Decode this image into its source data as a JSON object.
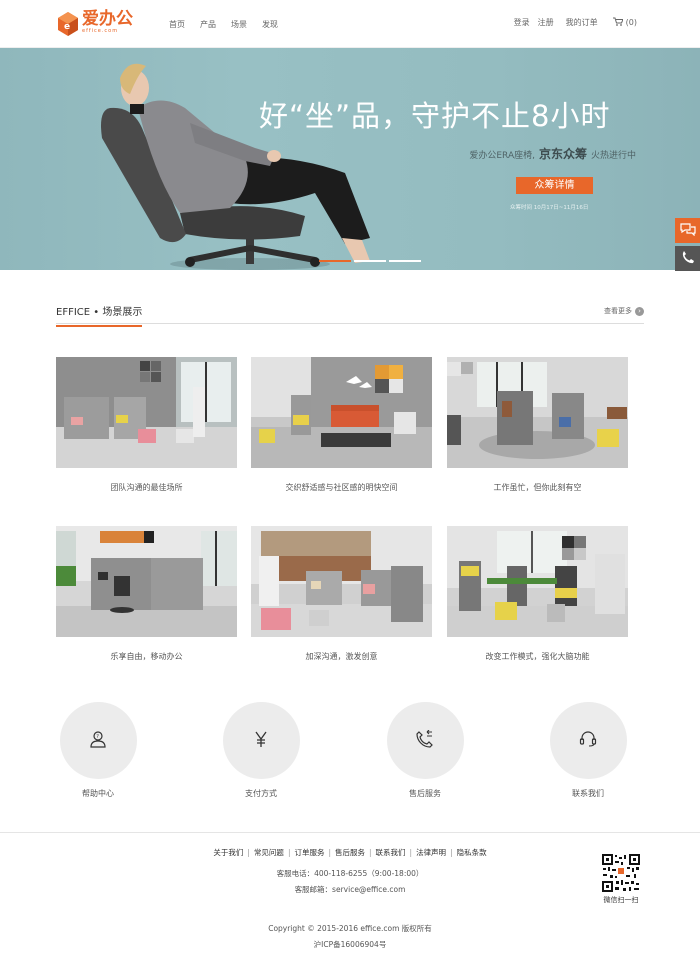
{
  "brand": {
    "name_cn": "爱办公",
    "name_en": "effice.com",
    "accent": "#e8672a"
  },
  "nav": {
    "items": [
      "首页",
      "产品",
      "场景",
      "发现"
    ]
  },
  "top_right": {
    "login": "登录",
    "register": "注册",
    "orders": "我的订单",
    "cart_count": "(0)"
  },
  "hero": {
    "title": "好“坐”品，守护不止8小时",
    "sub_prefix": "爱办公ERA座椅,",
    "sub_strong": "京东众筹",
    "sub_suffix": "火热进行中",
    "button": "众筹详情",
    "date": "众筹时间   10月17日~11月16日",
    "slides_total": 3,
    "active_slide": 1
  },
  "section": {
    "title": "EFFICE • 场景展示",
    "more": "查看更多"
  },
  "scenes": [
    {
      "caption": "团队沟通的最佳场所"
    },
    {
      "caption": "交织舒适感与社区感的明快空间"
    },
    {
      "caption": "工作虽忙，但你此刻有空"
    },
    {
      "caption": "乐享自由，移动办公"
    },
    {
      "caption": "加深沟通，激发创意"
    },
    {
      "caption": "改变工作模式，强化大脑功能"
    }
  ],
  "services": [
    {
      "label": "帮助中心",
      "icon": "help-user-icon"
    },
    {
      "label": "支付方式",
      "icon": "yen-icon"
    },
    {
      "label": "售后服务",
      "icon": "phone-return-icon"
    },
    {
      "label": "联系我们",
      "icon": "headset-icon"
    }
  ],
  "footer": {
    "links": [
      "关于我们",
      "常见问题",
      "订单服务",
      "售后服务",
      "联系我们",
      "法律声明",
      "隐私条款"
    ],
    "phone": "客服电话：400-118-6255（9:00-18:00）",
    "email": "客服邮箱：service@effice.com",
    "copyright": "Copyright © 2015-2016 effice.com 版权所有",
    "icp": "沪ICP备16006904号",
    "qr_label": "微信扫一扫"
  }
}
